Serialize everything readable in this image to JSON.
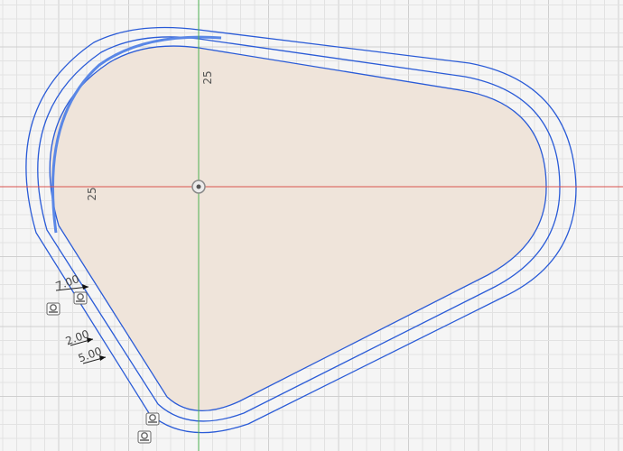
{
  "canvas": {
    "colors": {
      "background": "#f5f5f5",
      "grid_minor": "#e2e2e2",
      "grid_major": "#cfcfcf",
      "x_axis": "#d9534f",
      "y_axis": "#4caf50",
      "profile_fill": "#efe4da",
      "sketch_line": "#2a5bd7",
      "selected_line": "#5a87e6",
      "dimension_text": "#555555",
      "constraint_icon": "#666666"
    }
  },
  "dimensions": {
    "top_radius": "25",
    "left_radius": "25",
    "offset_outer": "7.00",
    "offset_mid": "2.00",
    "offset_inner": "5.00"
  },
  "constraint_icons": {
    "icon_name": "tangent-constraint-icon"
  }
}
